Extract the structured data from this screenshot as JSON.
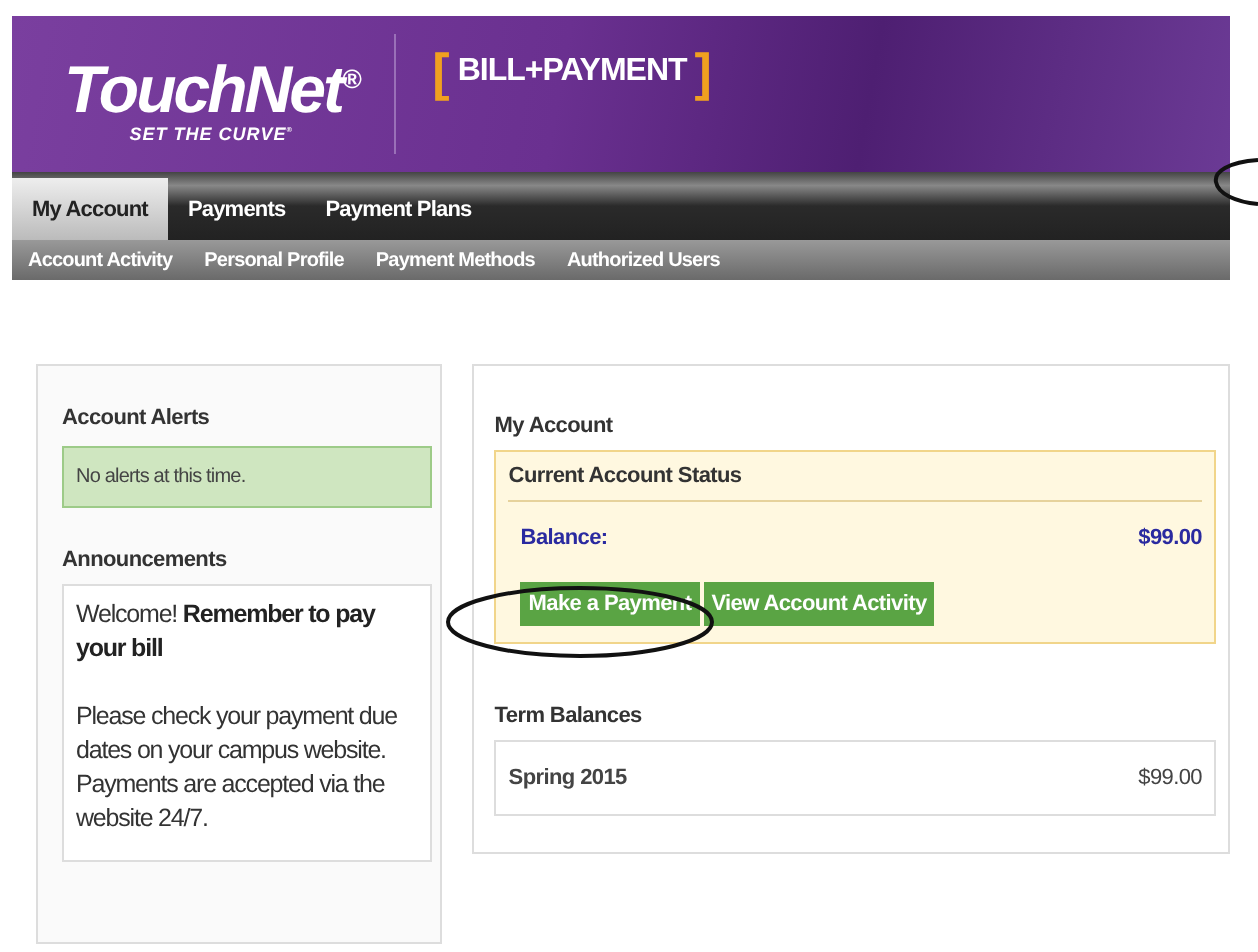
{
  "header": {
    "logo": "TouchNet$^{®}$",
    "tagline": "SET THE CURVE$^{®}$",
    "bracket_open": "[",
    "product": "BILL+PAYMENT",
    "bracket_close": "]"
  },
  "tabs": [
    {
      "label": "My Account",
      "selected": true
    },
    {
      "label": "Payments",
      "selected": false
    },
    {
      "label": "Payment Plans",
      "selected": false
    }
  ],
  "subnav": [
    "Account Activity",
    "Personal Profile",
    "Payment Methods",
    "Authorized Users"
  ],
  "alerts": {
    "title": "Account Alerts",
    "message": "No alerts at this time."
  },
  "announcements": {
    "title": "Announcements",
    "headline": "Welcome! **Remember to pay your bill**",
    "body": "Please check your payment due dates on your campus website. Payments are accepted via the website 24/7."
  },
  "account": {
    "title": "My Account",
    "status_title": "Current Account Status",
    "balance_label": "Balance:",
    "balance": "$99.00",
    "buttons": [
      "Make a Payment",
      "View Account Activity"
    ]
  },
  "term_balances": {
    "title": "Term Balances",
    "rows": [
      {
        "term": "Spring 2015",
        "amount": "$99.00"
      }
    ]
  }
}
